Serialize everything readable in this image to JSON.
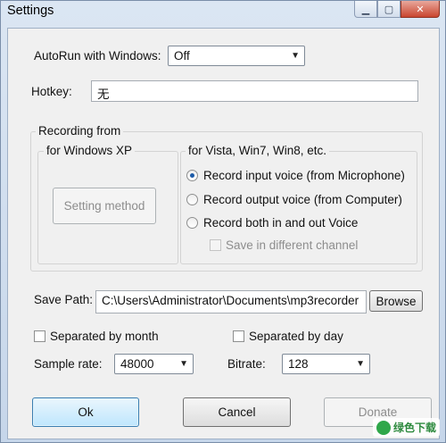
{
  "window": {
    "title": "Settings"
  },
  "autorun": {
    "label": "AutoRun with Windows:",
    "value": "Off"
  },
  "hotkey": {
    "label": "Hotkey:",
    "value": "无"
  },
  "recording": {
    "title": "Recording from",
    "xp": {
      "title": "for Windows XP",
      "button_label": "Setting method"
    },
    "vista": {
      "title": "for Vista, Win7, Win8, etc.",
      "options": [
        {
          "label": "Record input voice (from Microphone)",
          "checked": true
        },
        {
          "label": "Record output voice (from Computer)",
          "checked": false
        },
        {
          "label": "Record both in and out Voice",
          "checked": false
        }
      ],
      "separate_channel_label": "Save in different channel"
    }
  },
  "save_path": {
    "label": "Save Path:",
    "value": "C:\\Users\\Administrator\\Documents\\mp3recorder",
    "browse_label": "Browse"
  },
  "separate_month_label": "Separated by month",
  "separate_day_label": "Separated by day",
  "sample_rate": {
    "label": "Sample rate:",
    "value": "48000"
  },
  "bitrate": {
    "label": "Bitrate:",
    "value": "128"
  },
  "buttons": {
    "ok": "Ok",
    "cancel": "Cancel",
    "donate": "Donate"
  },
  "watermark": {
    "text": "绿色下载"
  },
  "icons": {
    "minimize": "minimize-icon",
    "maximize": "maximize-icon",
    "close": "close-icon",
    "dropdown": "chevron-down-icon"
  }
}
